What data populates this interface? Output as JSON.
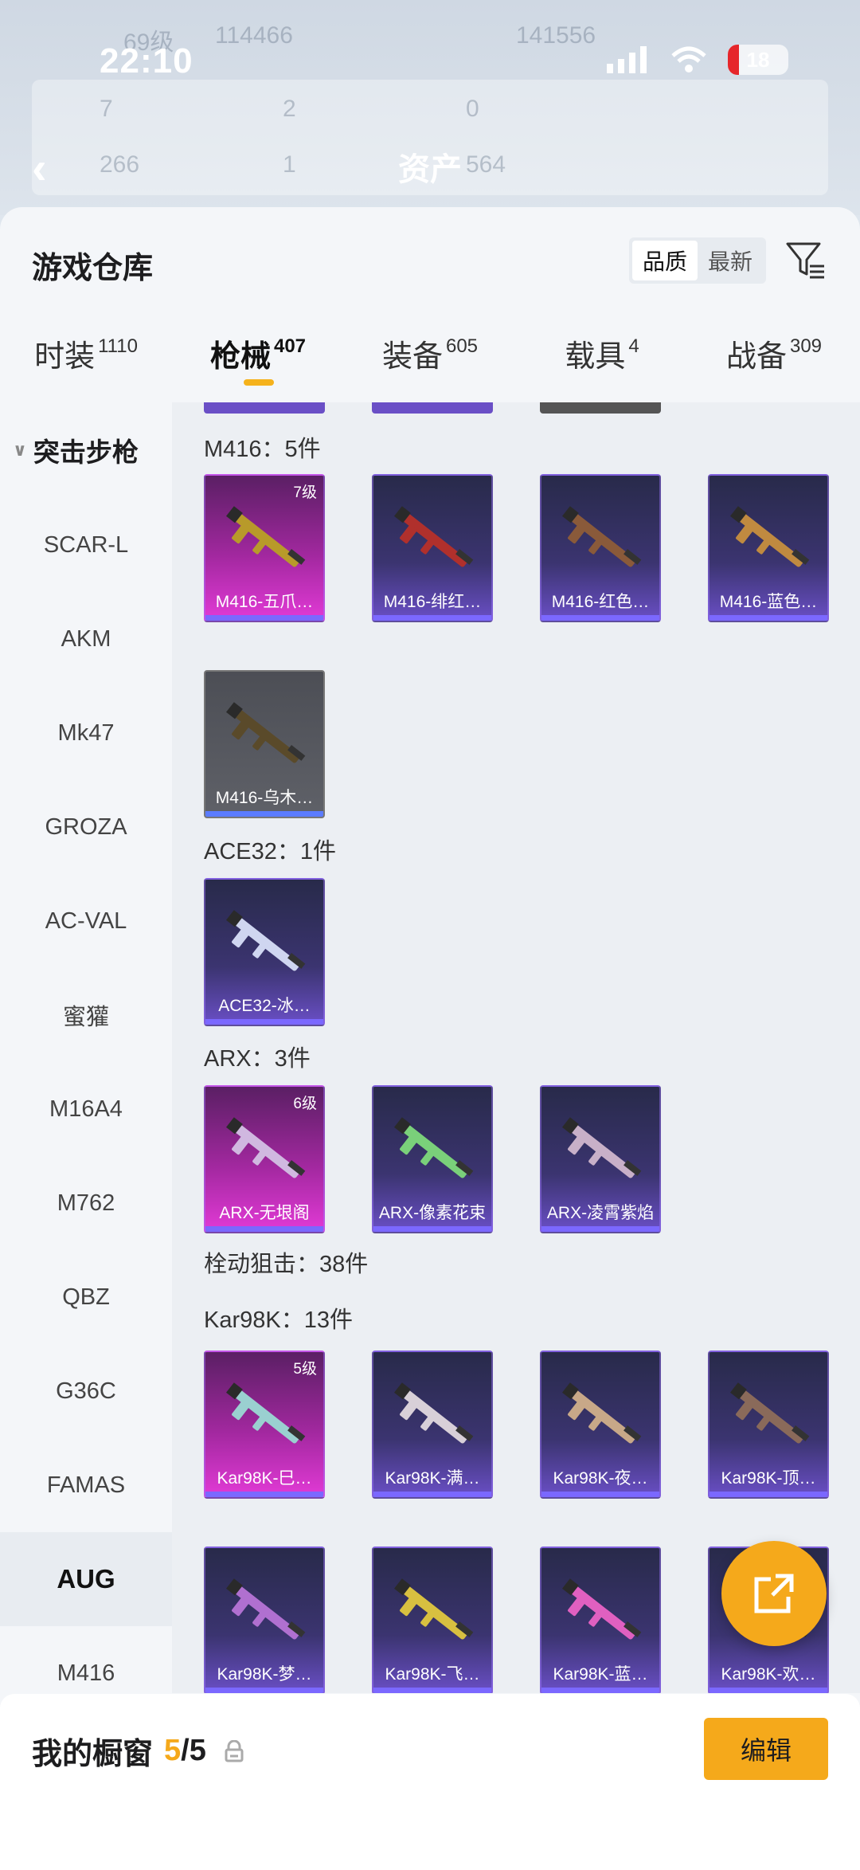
{
  "status_bar": {
    "time": "22:10",
    "battery": "18"
  },
  "background": {
    "level_text": "69级",
    "coins": "114466",
    "score": "141556",
    "stats": [
      "7",
      "2",
      "0",
      "266",
      "1",
      "564"
    ],
    "title": "资产"
  },
  "panel": {
    "title": "游戏仓库",
    "sort": {
      "quality": "品质",
      "newest": "最新"
    }
  },
  "tabs": [
    {
      "label": "时装",
      "count": "1110"
    },
    {
      "label": "枪械",
      "count": "407"
    },
    {
      "label": "装备",
      "count": "605"
    },
    {
      "label": "载具",
      "count": "4"
    },
    {
      "label": "战备",
      "count": "309"
    }
  ],
  "sidebar": {
    "header": "突击步枪",
    "items": [
      "SCAR-L",
      "AKM",
      "Mk47",
      "GROZA",
      "AC-VAL",
      "蜜獾",
      "M16A4",
      "M762",
      "QBZ",
      "G36C",
      "FAMAS",
      "AUG",
      "M416"
    ]
  },
  "groups": {
    "m416": "M416：5件",
    "ace32": "ACE32：1件",
    "arx": "ARX：3件",
    "sniper": "栓动狙击：38件",
    "kar98k": "Kar98K：13件"
  },
  "cards": {
    "m416": [
      {
        "name": "M416-五爪…",
        "level": "7级"
      },
      {
        "name": "M416-绯红…"
      },
      {
        "name": "M416-红色…"
      },
      {
        "name": "M416-蓝色…"
      },
      {
        "name": "M416-乌木…"
      }
    ],
    "ace32": [
      {
        "name": "ACE32-冰…"
      }
    ],
    "arx": [
      {
        "name": "ARX-无垠阁",
        "level": "6级"
      },
      {
        "name": "ARX-像素花束"
      },
      {
        "name": "ARX-凌霄紫焰"
      }
    ],
    "kar98k": [
      {
        "name": "Kar98K-巳…",
        "level": "5级"
      },
      {
        "name": "Kar98K-满…"
      },
      {
        "name": "Kar98K-夜…"
      },
      {
        "name": "Kar98K-顶…"
      },
      {
        "name": "Kar98K-梦…"
      },
      {
        "name": "Kar98K-飞…"
      },
      {
        "name": "Kar98K-蓝…"
      },
      {
        "name": "Kar98K-欢…"
      }
    ]
  },
  "showcase": {
    "title": "我的橱窗",
    "count": "5",
    "total": "/5",
    "edit": "编辑"
  },
  "colors": {
    "accent": "#f5a91b",
    "purple_card": "#3b3470",
    "pink_card": "#a2289f"
  },
  "icons": [
    "back-arrow-icon",
    "filter-icon",
    "chevron-down-icon",
    "lock-icon",
    "share-icon",
    "signal-icon",
    "wifi-icon",
    "battery-icon",
    "mute-icon"
  ]
}
